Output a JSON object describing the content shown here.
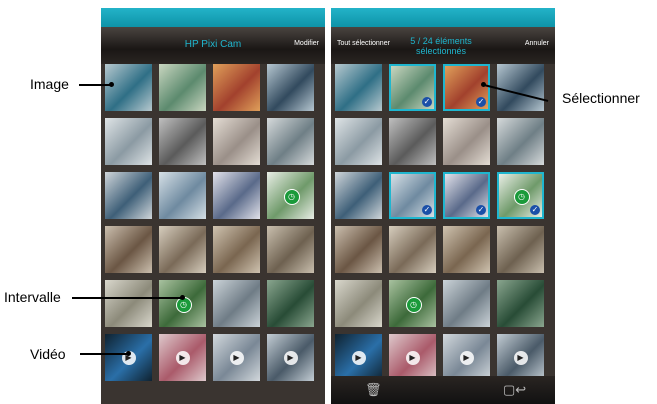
{
  "left": {
    "title": "HP Pixi Cam",
    "modifier_label": "Modifier"
  },
  "right": {
    "select_all_label": "Tout sélectionner",
    "count_line1": "5 / 24 éléments",
    "count_line2": "sélectionnés",
    "cancel_label": "Annuler",
    "delete_icon": "trash-icon",
    "send_icon": "phone-send-icon"
  },
  "callouts": {
    "image": "Image",
    "interval": "Intervalle",
    "video": "Vidéo",
    "select": "Sélectionner"
  },
  "grid": {
    "rows": 6,
    "cols": 4,
    "tiles": [
      {
        "kind": "photo",
        "c1": "#2f6f86",
        "c2": "#b7c9cf"
      },
      {
        "kind": "photo",
        "c1": "#5c8a6e",
        "c2": "#c9d6c0"
      },
      {
        "kind": "photo",
        "c1": "#a2412d",
        "c2": "#e0a05a"
      },
      {
        "kind": "photo",
        "c1": "#324a5e",
        "c2": "#b6c7d1"
      },
      {
        "kind": "photo",
        "c1": "#8b9aa3",
        "c2": "#dfe4e6"
      },
      {
        "kind": "photo",
        "c1": "#5b5b5b",
        "c2": "#c0c0c0"
      },
      {
        "kind": "photo",
        "c1": "#9a8f88",
        "c2": "#e4ddd4"
      },
      {
        "kind": "photo",
        "c1": "#6f7f86",
        "c2": "#d6dadb"
      },
      {
        "kind": "photo",
        "c1": "#3e5f78",
        "c2": "#d0d6da"
      },
      {
        "kind": "photo",
        "c1": "#6f8aa0",
        "c2": "#d6e0e6"
      },
      {
        "kind": "photo",
        "c1": "#5a6a8a",
        "c2": "#e2e2ea"
      },
      {
        "kind": "interval",
        "c1": "#6f9a6a",
        "c2": "#e9eee6"
      },
      {
        "kind": "photo",
        "c1": "#6b5644",
        "c2": "#cbbfae"
      },
      {
        "kind": "photo",
        "c1": "#7a6a58",
        "c2": "#d6cdbd"
      },
      {
        "kind": "photo",
        "c1": "#7a6650",
        "c2": "#cfc3b0"
      },
      {
        "kind": "photo",
        "c1": "#6e6150",
        "c2": "#c9bfae"
      },
      {
        "kind": "photo",
        "c1": "#8c8a7a",
        "c2": "#d9d7cc"
      },
      {
        "kind": "interval",
        "c1": "#3d6a3a",
        "c2": "#a9c2a0"
      },
      {
        "kind": "photo",
        "c1": "#6f7c86",
        "c2": "#cbd3d8"
      },
      {
        "kind": "photo",
        "c1": "#284c36",
        "c2": "#8aa68f"
      },
      {
        "kind": "video",
        "c1": "#2a6fa8",
        "c2": "#0f2230"
      },
      {
        "kind": "video",
        "c1": "#aa5a6a",
        "c2": "#dec9cc"
      },
      {
        "kind": "video",
        "c1": "#7a8896",
        "c2": "#d2d8dc"
      },
      {
        "kind": "video",
        "c1": "#4a5a68",
        "c2": "#c3cdd4"
      }
    ],
    "selected_right": [
      1,
      2,
      9,
      10,
      11
    ]
  }
}
